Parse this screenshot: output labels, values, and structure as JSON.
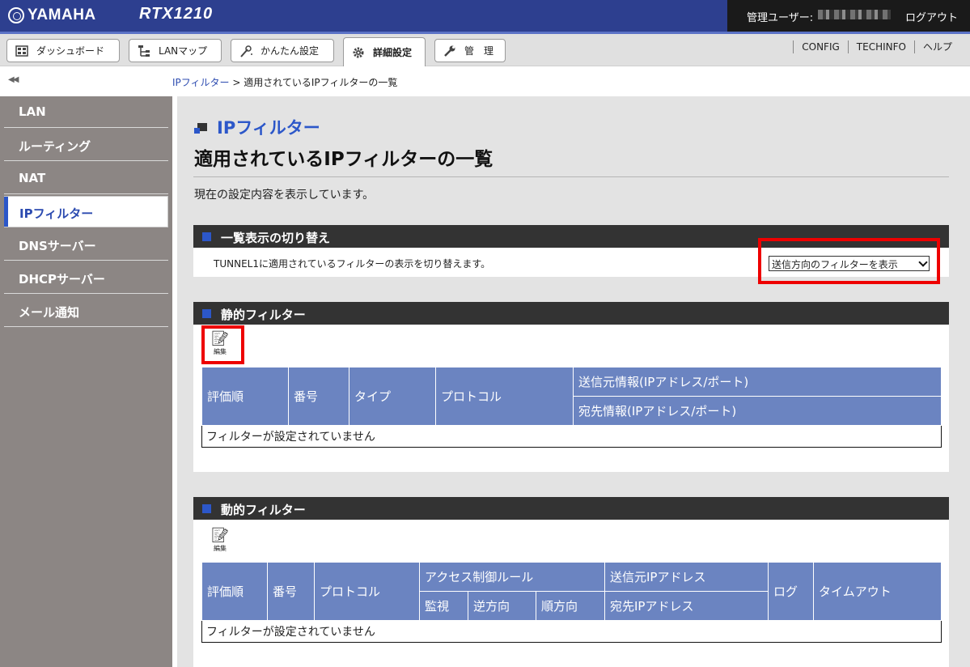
{
  "header": {
    "brand": "YAMAHA",
    "model": "RTX1210",
    "user_label": "管理ユーザー:",
    "logout": "ログアウト"
  },
  "nav": {
    "tabs": [
      {
        "label": "ダッシュボード",
        "icon": "dashboard-icon"
      },
      {
        "label": "LANマップ",
        "icon": "lan-map-icon"
      },
      {
        "label": "かんたん設定",
        "icon": "wizard-icon"
      },
      {
        "label": "詳細設定",
        "icon": "gear-icon",
        "active": true
      },
      {
        "label": "管　理",
        "icon": "wrench-icon"
      }
    ],
    "links": [
      "CONFIG",
      "TECHINFO",
      "ヘルプ"
    ]
  },
  "breadcrumb": {
    "parent": "IPフィルター",
    "separator": " > ",
    "current": "適用されているIPフィルターの一覧"
  },
  "sidebar": {
    "items": [
      "LAN",
      "ルーティング",
      "NAT",
      "IPフィルター",
      "DNSサーバー",
      "DHCPサーバー",
      "メール通知"
    ],
    "active_index": 3
  },
  "page": {
    "title": "IPフィルター",
    "subtitle": "適用されているIPフィルターの一覧",
    "description": "現在の設定内容を表示しています。"
  },
  "switch_section": {
    "heading": "一覧表示の切り替え",
    "text": "TUNNEL1に適用されているフィルターの表示を切り替えます。",
    "select_value": "送信方向のフィルターを表示"
  },
  "static_section": {
    "heading": "静的フィルター",
    "edit_label": "編集",
    "columns": {
      "order": "評価順",
      "number": "番号",
      "type": "タイプ",
      "protocol": "プロトコル",
      "src": "送信元情報(IPアドレス/ポート)",
      "dst": "宛先情報(IPアドレス/ポート)"
    },
    "empty": "フィルターが設定されていません"
  },
  "dynamic_section": {
    "heading": "動的フィルター",
    "edit_label": "編集",
    "columns": {
      "order": "評価順",
      "number": "番号",
      "protocol": "プロトコル",
      "access": "アクセス制御ルール",
      "monitor": "監視",
      "reverse": "逆方向",
      "forward": "順方向",
      "src_ip": "送信元IPアドレス",
      "dst_ip": "宛先IPアドレス",
      "log": "ログ",
      "timeout": "タイムアウト"
    },
    "empty": "フィルターが設定されていません"
  }
}
